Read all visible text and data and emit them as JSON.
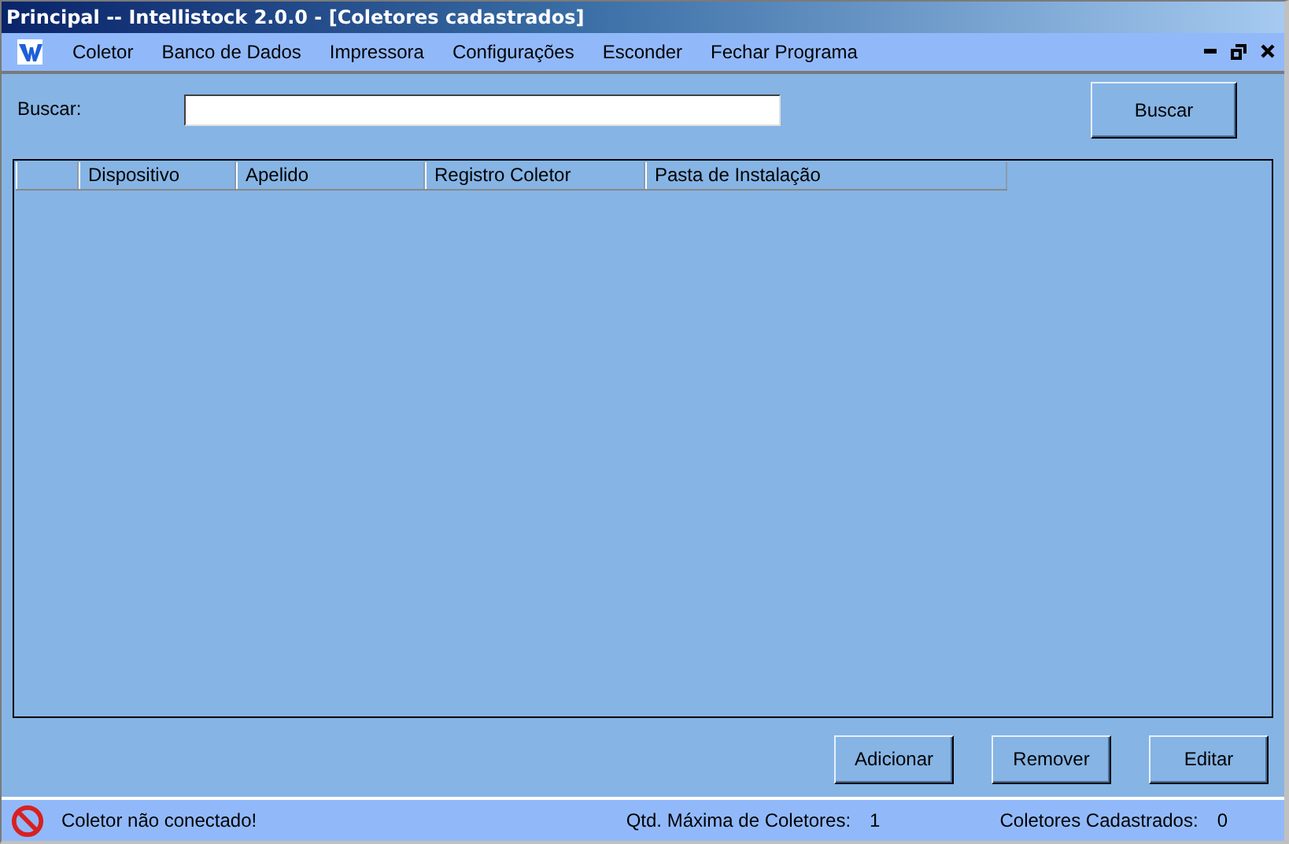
{
  "window": {
    "title": "Principal -- Intellistock 2.0.0 - [Coletores cadastrados]"
  },
  "menu": [
    "Coletor",
    "Banco de Dados",
    "Impressora",
    "Configurações",
    "Esconder",
    "Fechar Programa"
  ],
  "search": {
    "label": "Buscar:",
    "button": "Buscar"
  },
  "table": {
    "columns": [
      "Dispositivo",
      "Apelido",
      "Registro Coletor",
      "Pasta de Instalação"
    ]
  },
  "buttons": [
    "Adicionar",
    "Remover",
    "Editar"
  ],
  "status_bar": {
    "message": "Coletor não conectado!",
    "max_label": "Qtd. Máxima de Coletores:",
    "max_value": "1",
    "count_label": "Coletores Cadastrados:",
    "count_value": "0"
  }
}
